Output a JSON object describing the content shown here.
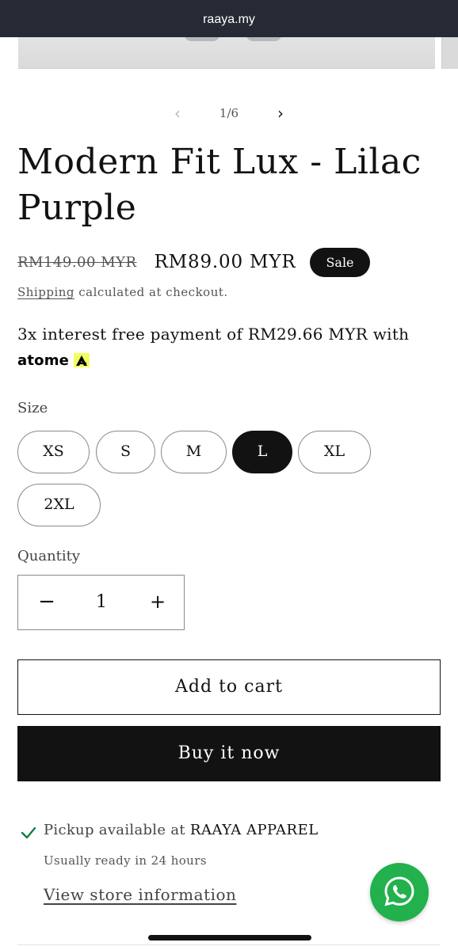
{
  "browser": {
    "url": "raaya.my"
  },
  "gallery": {
    "prev_icon": "chevron-left-icon",
    "next_icon": "chevron-right-icon",
    "counter": "1/6"
  },
  "product": {
    "title": "Modern Fit Lux - Lilac Purple",
    "regular_price": "RM149.00 MYR",
    "sale_price": "RM89.00 MYR",
    "badge": "Sale",
    "shipping_link": "Shipping",
    "shipping_rest": "calculated at checkout.",
    "installment_text": "3x interest free payment of RM29.66 MYR with",
    "installment_brand": "atome",
    "installment_brand_color": "#f0ff5f"
  },
  "size": {
    "label": "Size",
    "options": [
      "XS",
      "S",
      "M",
      "L",
      "XL",
      "2XL"
    ],
    "selected": "L"
  },
  "quantity": {
    "label": "Quantity",
    "value": "1",
    "decrease_icon": "minus-icon",
    "increase_icon": "plus-icon"
  },
  "actions": {
    "add_to_cart": "Add to cart",
    "buy_now": "Buy it now"
  },
  "pickup": {
    "icon": "checkmark-icon",
    "icon_color": "#108043",
    "available_prefix": "Pickup available at",
    "store_name": "RAAYA APPAREL",
    "ready_note": "Usually ready in 24 hours",
    "store_info_link": "View store information"
  },
  "chat": {
    "icon": "whatsapp-icon",
    "color": "#22b14c"
  }
}
